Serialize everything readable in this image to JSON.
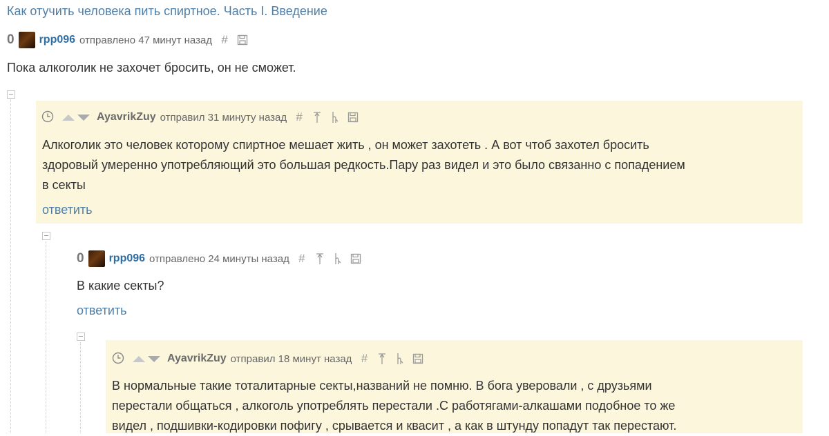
{
  "post": {
    "title": "Как отучить человека пить спиртное. Часть I. Введение"
  },
  "comments": [
    {
      "score": "0",
      "user": "rpp096",
      "time": "отправлено 47 минут назад",
      "text": "Пока алкоголик не захочет бросить, он не сможет."
    },
    {
      "user": "AyavrikZuy",
      "time": "отправил 31 минуту назад",
      "text": [
        "Алкоголик это человек которому спиртное мешает жить , он может захотеть . А вот чтоб захотел бросить",
        "здоровый умеренно употребляющий это большая редкость.Пару раз видел и это было связанно с попадением",
        "в секты"
      ],
      "reply": "ответить"
    },
    {
      "score": "0",
      "user": "rpp096",
      "time": "отправлено 24 минуты назад",
      "text": "В какие секты?",
      "reply": "ответить"
    },
    {
      "user": "AyavrikZuy",
      "time": "отправил 18 минут назад",
      "text": [
        "В нормальные такие тоталитарные секты,названий не помню. В бога уверовали , с друзьями",
        "перестали общаться , алкоголь употреблять перестали .С работягами-алкашами подобное то же",
        "видел , подшивки-кодировки пофигу , срывается и квасит , а как в штунду попадут так перестают."
      ]
    }
  ],
  "icons": {
    "permalink": "hash-icon",
    "parent": "arrow-up-icon",
    "thread": "thread-icon",
    "save": "save-icon",
    "clock": "clock-icon"
  },
  "colors": {
    "link": "#4e7fa8",
    "username": "#2e6ea6",
    "highlight": "#fbf6dc"
  }
}
